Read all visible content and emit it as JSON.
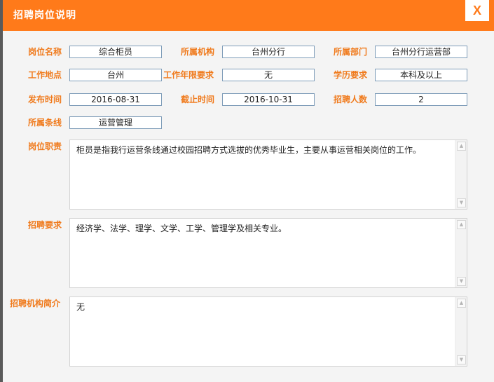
{
  "dialog": {
    "title": "招聘岗位说明",
    "close_label": "X"
  },
  "fields": {
    "post_name": {
      "label": "岗位名称",
      "value": "综合柜员"
    },
    "institution": {
      "label": "所属机构",
      "value": "台州分行"
    },
    "department": {
      "label": "所属部门",
      "value": "台州分行运营部"
    },
    "work_location": {
      "label": "工作地点",
      "value": "台州"
    },
    "work_years": {
      "label": "工作年限要求",
      "value": "无"
    },
    "education": {
      "label": "学历要求",
      "value": "本科及以上"
    },
    "publish_date": {
      "label": "发布时间",
      "value": "2016-08-31"
    },
    "deadline": {
      "label": "截止时间",
      "value": "2016-10-31"
    },
    "headcount": {
      "label": "招聘人数",
      "value": "2"
    },
    "business_line": {
      "label": "所属条线",
      "value": "运营管理"
    }
  },
  "sections": {
    "duties": {
      "label": "岗位职责",
      "text": "柜员是指我行运营条线通过校园招聘方式选拔的优秀毕业生，主要从事运营相关岗位的工作。"
    },
    "requirements": {
      "label": "招聘要求",
      "text": "经济学、法学、理学、文学、工学、管理学及相关专业。"
    },
    "org_intro": {
      "label": "招聘机构简介",
      "text": "无"
    }
  }
}
